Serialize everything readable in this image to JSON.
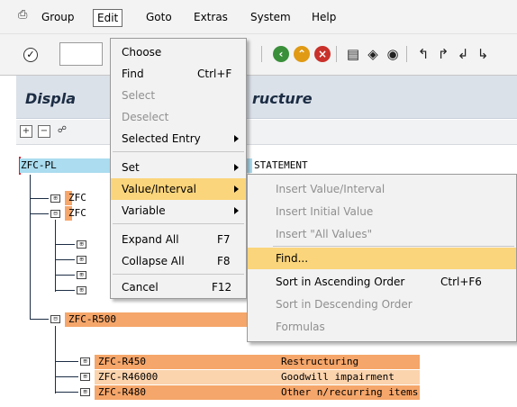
{
  "menubar": {
    "items": [
      {
        "label": "Group"
      },
      {
        "label": "Edit"
      },
      {
        "label": "Goto"
      },
      {
        "label": "Extras"
      },
      {
        "label": "System"
      },
      {
        "label": "Help"
      }
    ]
  },
  "screen": {
    "title_left": "Displa",
    "title_right": "ructure"
  },
  "tree": {
    "root": {
      "label": "ZFC-PL",
      "description": "STATEMENT"
    },
    "level1_fragments": [
      "ZFC",
      "ZFC"
    ],
    "node_r500": {
      "label": "ZFC-R500"
    },
    "children": [
      {
        "label": "ZFC-R450",
        "description": "Restructuring"
      },
      {
        "label": "ZFC-R46000",
        "description": "Goodwill impairment"
      },
      {
        "label": "ZFC-R480",
        "description": "Other n/recurring items"
      }
    ]
  },
  "edit_menu": {
    "items": [
      {
        "label": "Choose"
      },
      {
        "label": "Find",
        "shortcut": "Ctrl+F"
      },
      {
        "label": "Select"
      },
      {
        "label": "Deselect"
      },
      {
        "label": "Selected Entry"
      },
      {
        "label": "Set"
      },
      {
        "label": "Value/Interval"
      },
      {
        "label": "Variable"
      },
      {
        "label": "Expand All",
        "shortcut": "F7"
      },
      {
        "label": "Collapse All",
        "shortcut": "F8"
      },
      {
        "label": "Cancel",
        "shortcut": "F12"
      }
    ]
  },
  "submenu": {
    "items": [
      {
        "label": "Insert Value/Interval"
      },
      {
        "label": "Insert Initial Value"
      },
      {
        "label": "Insert \"All Values\""
      },
      {
        "label": "Find..."
      },
      {
        "label": "Sort in Ascending Order",
        "shortcut": "Ctrl+F6"
      },
      {
        "label": "Sort in Descending Order"
      },
      {
        "label": "Formulas"
      }
    ]
  },
  "colors": {
    "highlight": "#fbd57b",
    "root_bg": "#abdcf0",
    "node_orange": "#f5a66a",
    "node_peach": "#fbd3ad",
    "titlebar_bg": "#dbe1e9"
  }
}
